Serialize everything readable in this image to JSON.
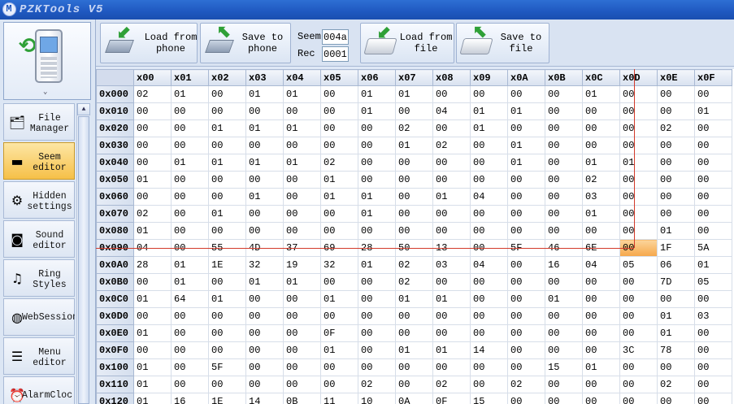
{
  "app": {
    "title": "PZKTools V5"
  },
  "sidebar": {
    "items": [
      {
        "label": "File\nManager",
        "icon": "file-manager-icon",
        "active": false
      },
      {
        "label": "Seem\neditor",
        "icon": "seem-editor-icon",
        "active": true
      },
      {
        "label": "Hidden\nsettings",
        "icon": "gears-icon",
        "active": false
      },
      {
        "label": "Sound\neditor",
        "icon": "speaker-icon",
        "active": false
      },
      {
        "label": "Ring\nStyles",
        "icon": "ring-icon",
        "active": false
      },
      {
        "label": "WebSession",
        "icon": "globe-icon",
        "active": false
      },
      {
        "label": "Menu\neditor",
        "icon": "menu-icon",
        "active": false
      },
      {
        "label": "AlarmCloc",
        "icon": "alarm-icon",
        "active": false
      }
    ]
  },
  "toolbar": {
    "load_phone": "Load from\nphone",
    "save_phone": "Save to\nphone",
    "seem_label": "Seem",
    "seem_value": "004a",
    "rec_label": "Rec",
    "rec_value": "0001",
    "load_file": "Load from\nfile",
    "save_file": "Save to\nfile"
  },
  "grid": {
    "columns": [
      "x00",
      "x01",
      "x02",
      "x03",
      "x04",
      "x05",
      "x06",
      "x07",
      "x08",
      "x09",
      "x0A",
      "x0B",
      "x0C",
      "x0D",
      "x0E",
      "x0F"
    ],
    "selected": {
      "row": "0x090",
      "col": "x0D"
    },
    "rows": [
      {
        "addr": "0x000",
        "cells": [
          "02",
          "01",
          "00",
          "01",
          "01",
          "00",
          "01",
          "01",
          "00",
          "00",
          "00",
          "00",
          "01",
          "00",
          "00",
          "00"
        ]
      },
      {
        "addr": "0x010",
        "cells": [
          "00",
          "00",
          "00",
          "00",
          "00",
          "00",
          "01",
          "00",
          "04",
          "01",
          "01",
          "00",
          "00",
          "00",
          "00",
          "01"
        ]
      },
      {
        "addr": "0x020",
        "cells": [
          "00",
          "00",
          "01",
          "01",
          "01",
          "00",
          "00",
          "02",
          "00",
          "01",
          "00",
          "00",
          "00",
          "00",
          "02",
          "00"
        ]
      },
      {
        "addr": "0x030",
        "cells": [
          "00",
          "00",
          "00",
          "00",
          "00",
          "00",
          "00",
          "01",
          "02",
          "00",
          "01",
          "00",
          "00",
          "00",
          "00",
          "00"
        ]
      },
      {
        "addr": "0x040",
        "cells": [
          "00",
          "01",
          "01",
          "01",
          "01",
          "02",
          "00",
          "00",
          "00",
          "00",
          "01",
          "00",
          "01",
          "01",
          "00",
          "00"
        ]
      },
      {
        "addr": "0x050",
        "cells": [
          "01",
          "00",
          "00",
          "00",
          "00",
          "01",
          "00",
          "00",
          "00",
          "00",
          "00",
          "00",
          "02",
          "00",
          "00",
          "00"
        ]
      },
      {
        "addr": "0x060",
        "cells": [
          "00",
          "00",
          "00",
          "01",
          "00",
          "01",
          "01",
          "00",
          "01",
          "04",
          "00",
          "00",
          "03",
          "00",
          "00",
          "00"
        ]
      },
      {
        "addr": "0x070",
        "cells": [
          "02",
          "00",
          "01",
          "00",
          "00",
          "00",
          "01",
          "00",
          "00",
          "00",
          "00",
          "00",
          "01",
          "00",
          "00",
          "00"
        ]
      },
      {
        "addr": "0x080",
        "cells": [
          "01",
          "00",
          "00",
          "00",
          "00",
          "00",
          "00",
          "00",
          "00",
          "00",
          "00",
          "00",
          "00",
          "00",
          "01",
          "00"
        ]
      },
      {
        "addr": "0x090",
        "cells": [
          "04",
          "00",
          "55",
          "4D",
          "37",
          "69",
          "28",
          "50",
          "13",
          "00",
          "5F",
          "46",
          "6E",
          "00",
          "1F",
          "5A"
        ]
      },
      {
        "addr": "0x0A0",
        "cells": [
          "28",
          "01",
          "1E",
          "32",
          "19",
          "32",
          "01",
          "02",
          "03",
          "04",
          "00",
          "16",
          "04",
          "05",
          "06",
          "01"
        ]
      },
      {
        "addr": "0x0B0",
        "cells": [
          "00",
          "01",
          "00",
          "01",
          "01",
          "00",
          "00",
          "02",
          "00",
          "00",
          "00",
          "00",
          "00",
          "00",
          "7D",
          "05"
        ]
      },
      {
        "addr": "0x0C0",
        "cells": [
          "01",
          "64",
          "01",
          "00",
          "00",
          "01",
          "00",
          "01",
          "01",
          "00",
          "00",
          "01",
          "00",
          "00",
          "00",
          "00"
        ]
      },
      {
        "addr": "0x0D0",
        "cells": [
          "00",
          "00",
          "00",
          "00",
          "00",
          "00",
          "00",
          "00",
          "00",
          "00",
          "00",
          "00",
          "00",
          "00",
          "01",
          "03"
        ]
      },
      {
        "addr": "0x0E0",
        "cells": [
          "01",
          "00",
          "00",
          "00",
          "00",
          "0F",
          "00",
          "00",
          "00",
          "00",
          "00",
          "00",
          "00",
          "00",
          "01",
          "00"
        ]
      },
      {
        "addr": "0x0F0",
        "cells": [
          "00",
          "00",
          "00",
          "00",
          "00",
          "01",
          "00",
          "01",
          "01",
          "14",
          "00",
          "00",
          "00",
          "3C",
          "78",
          "00"
        ]
      },
      {
        "addr": "0x100",
        "cells": [
          "01",
          "00",
          "5F",
          "00",
          "00",
          "00",
          "00",
          "00",
          "00",
          "00",
          "00",
          "15",
          "01",
          "00",
          "00",
          "00"
        ]
      },
      {
        "addr": "0x110",
        "cells": [
          "01",
          "00",
          "00",
          "00",
          "00",
          "00",
          "02",
          "00",
          "02",
          "00",
          "02",
          "00",
          "00",
          "00",
          "02",
          "00"
        ]
      },
      {
        "addr": "0x120",
        "cells": [
          "01",
          "16",
          "1E",
          "14",
          "0B",
          "11",
          "10",
          "0A",
          "0F",
          "15",
          "00",
          "00",
          "00",
          "00",
          "00",
          "00"
        ]
      }
    ]
  },
  "colors": {
    "selection": "#f6a74a",
    "crosshair": "#d23a2a",
    "active_item": "#f6c048"
  }
}
